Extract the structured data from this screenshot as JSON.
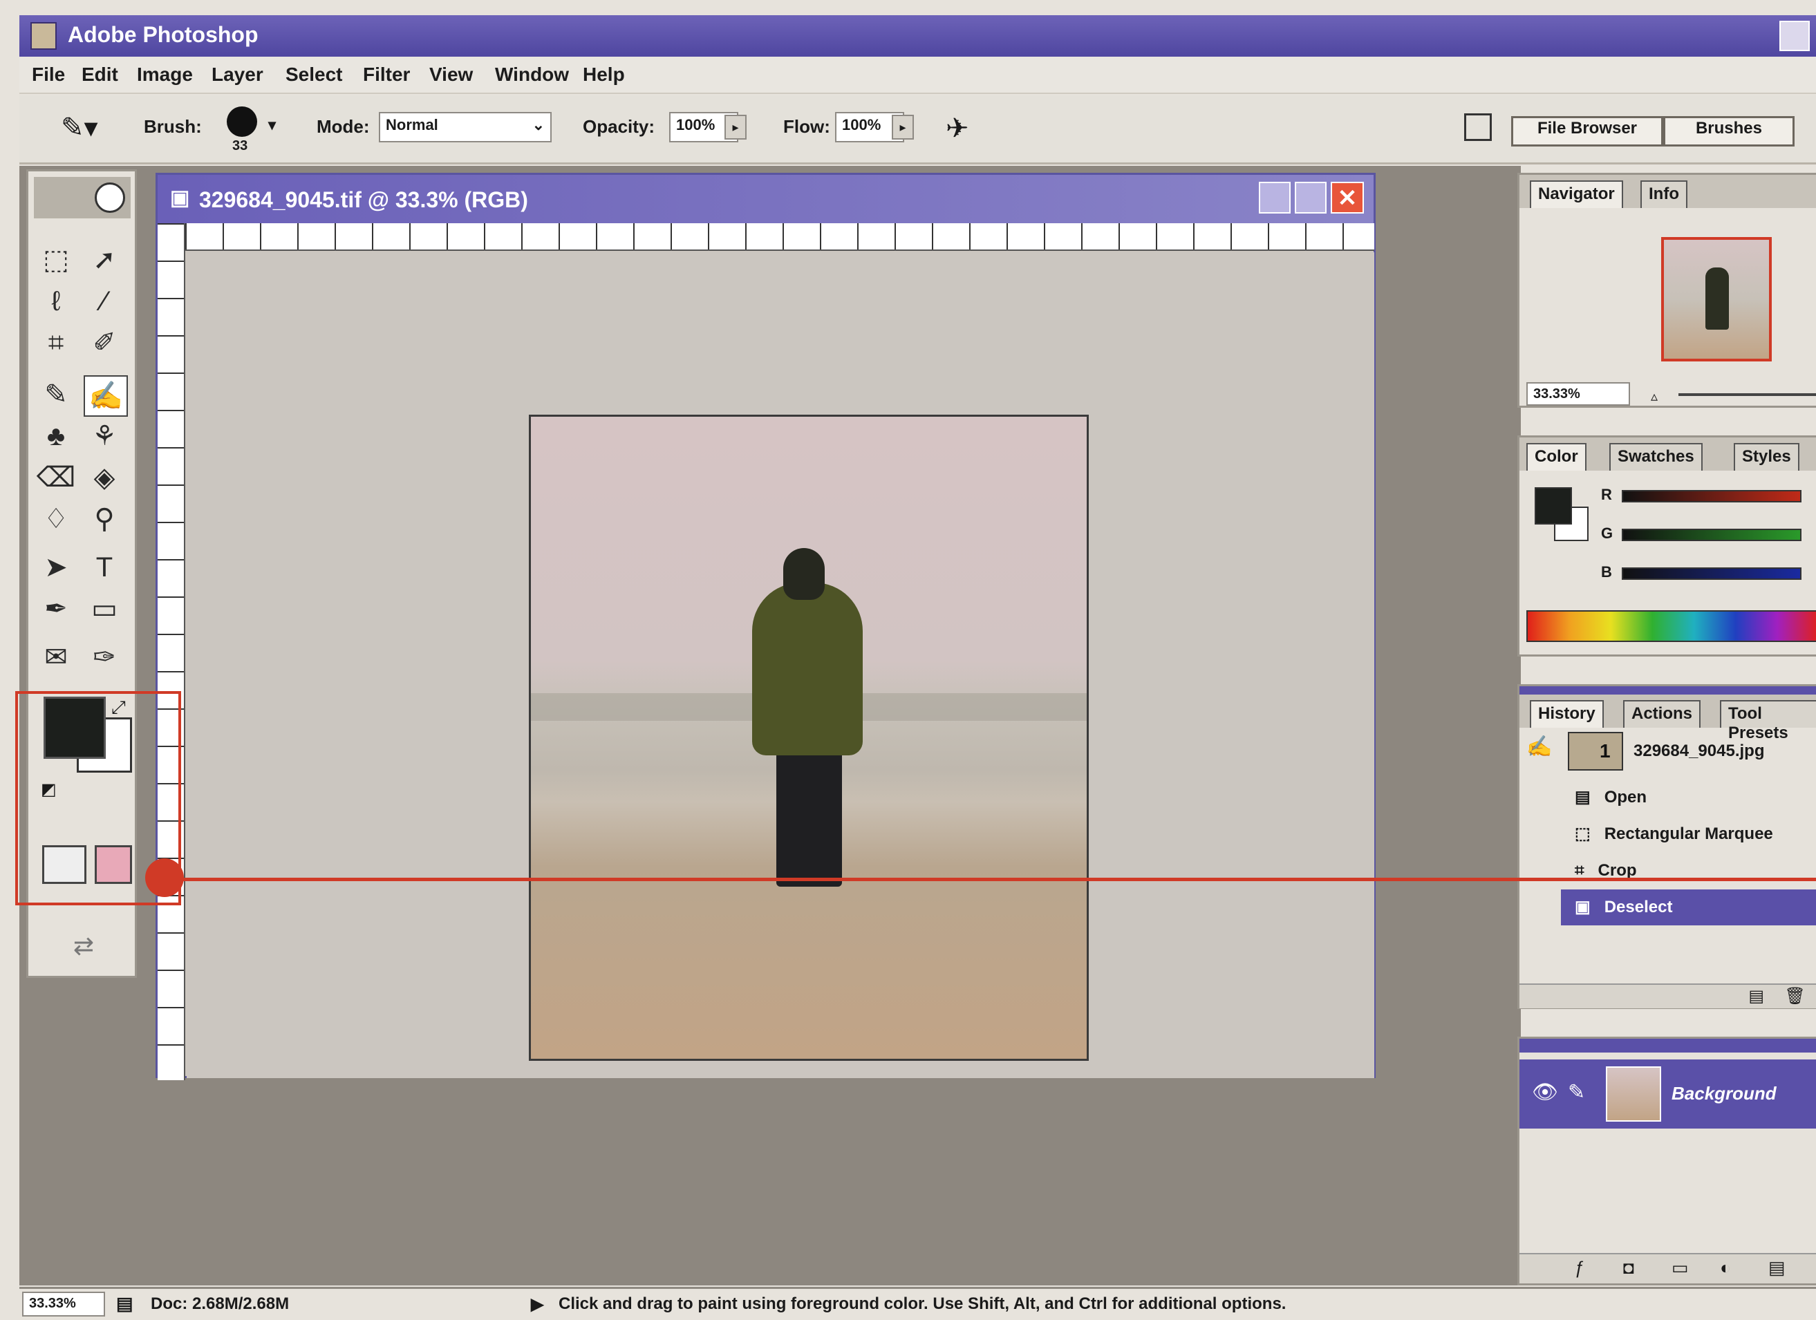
{
  "app": {
    "title": "Adobe Photoshop"
  },
  "menu": [
    "File",
    "Edit",
    "Image",
    "Layer",
    "Select",
    "Filter",
    "View",
    "Window",
    "Help"
  ],
  "options_bar": {
    "brush_label": "Brush:",
    "brush_size": "33",
    "mode_label": "Mode:",
    "mode_value": "Normal",
    "opacity_label": "Opacity:",
    "opacity_value": "100%",
    "flow_label": "Flow:",
    "flow_value": "100%",
    "tab_file_browser": "File Browser",
    "tab_brushes": "Brushes"
  },
  "document": {
    "title": "329684_9045.tif @ 33.3% (RGB)"
  },
  "navigator_panel": {
    "tabs": [
      "Navigator",
      "Info"
    ],
    "zoom": "33.33%"
  },
  "color_panel": {
    "tabs": [
      "Color",
      "Swatches",
      "Styles"
    ],
    "channels": [
      "R",
      "G",
      "B"
    ]
  },
  "history_panel": {
    "tabs": [
      "History",
      "Actions",
      "Tool Presets"
    ],
    "snapshot": "329684_9045.jpg",
    "snapshot_number": "1",
    "steps": [
      "Open",
      "Rectangular Marquee",
      "Crop",
      "Deselect"
    ],
    "selected_step": "Deselect"
  },
  "layers_panel": {
    "layer_name": "Background"
  },
  "status_bar": {
    "zoom": "33.33%",
    "doc_size": "Doc: 2.68M/2.68M",
    "hint": "Click and drag to paint using foreground color. Use Shift, Alt, and Ctrl for additional options."
  },
  "colors": {
    "title_bar": "#5a50a8",
    "callout": "#d03a26",
    "foreground": "#1c1f1c",
    "background": "#ffffff"
  },
  "icons": {
    "toolbox": [
      "marquee-icon",
      "move-icon",
      "lasso-icon",
      "magic-wand-icon",
      "crop-icon",
      "slice-icon",
      "healing-brush-icon",
      "brush-icon",
      "clone-stamp-icon",
      "history-brush-icon",
      "eraser-icon",
      "gradient-icon",
      "blur-icon",
      "dodge-icon",
      "path-selection-icon",
      "type-icon",
      "pen-icon",
      "shape-icon",
      "notes-icon",
      "eyedropper-icon"
    ]
  }
}
